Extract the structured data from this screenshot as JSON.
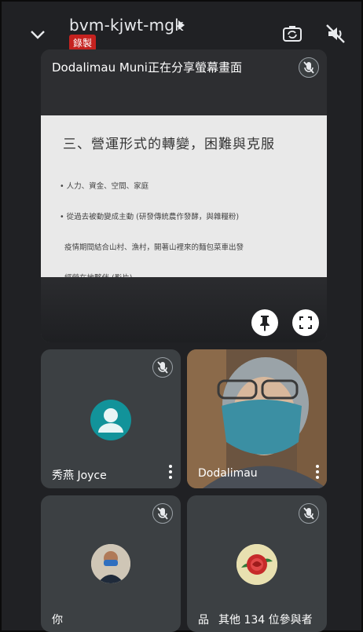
{
  "meeting": {
    "code": "bvm-kjwt-mgk",
    "recording_badge": "錄製"
  },
  "share": {
    "presenter_label": "Dodalimau Muni正在分享螢幕畫面",
    "slide_title": "三、營運形式的轉變，困難與克服",
    "slide_lines": [
      "• 人力、資金、空間、家庭",
      "• 從過去被動變成主動 (研發傳統農作發酵，與雜糧粉)",
      "  疫情期間結合山村、漁村，開著山裡來的麵包菜車出發",
      "  經營在地夥伴 (影片)"
    ]
  },
  "participants": [
    {
      "name": "秀燕 Joyce",
      "avatar_color": "#12939a"
    },
    {
      "name": "Dodalimau"
    },
    {
      "name": "你"
    },
    {
      "name": "品"
    }
  ],
  "others": {
    "label": "其他 134 位參與者"
  },
  "colors": {
    "accent_red": "#c5221f",
    "tile_bg": "#3c4043",
    "page_bg": "#202124"
  }
}
